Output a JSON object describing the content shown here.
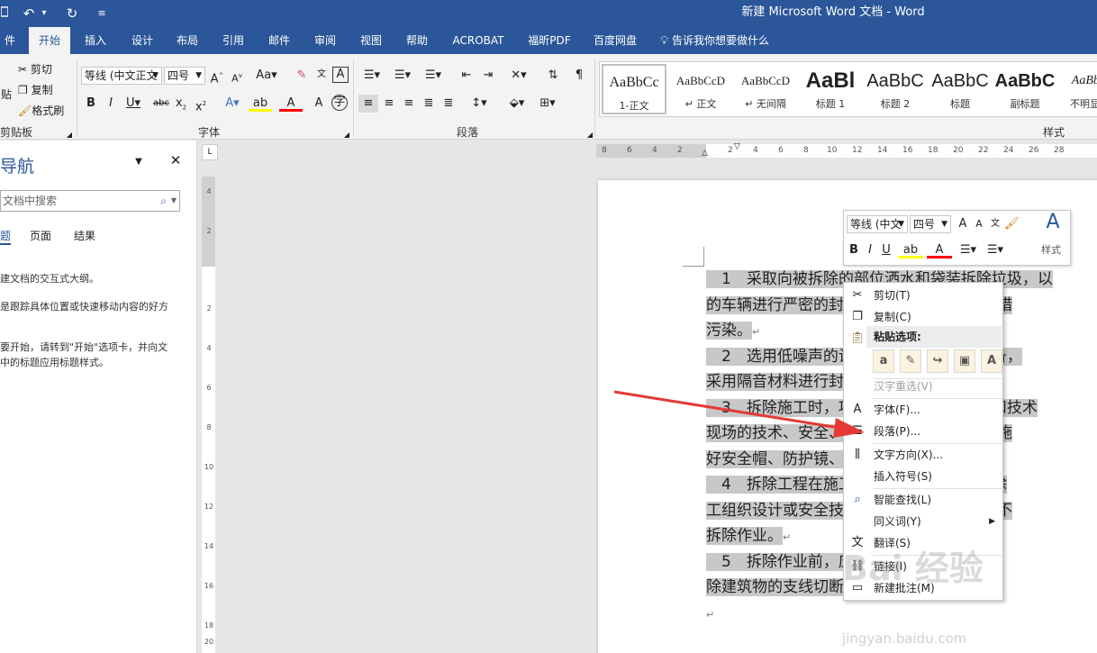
{
  "window": {
    "title": "新建 Microsoft Word 文档  -  Word"
  },
  "qat": {
    "save_icon": "save-icon",
    "undo": "↶",
    "undo_caret": "▾",
    "redo": "↻",
    "customize": "≡"
  },
  "tabs": [
    "件",
    "开始",
    "插入",
    "设计",
    "布局",
    "引用",
    "邮件",
    "审阅",
    "视图",
    "帮助",
    "ACROBAT",
    "福昕PDF",
    "百度网盘"
  ],
  "tell_me": "告诉我你想要做什么",
  "ribbon": {
    "clipboard": {
      "cut": "剪切",
      "copy": "复制",
      "format_painter": "格式刷",
      "paste": "贴",
      "label": "剪贴板"
    },
    "font": {
      "name": "等线 (中文正文",
      "size": "四号",
      "label": "字体"
    },
    "paragraph": {
      "label": "段落"
    },
    "styles": {
      "label": "样式",
      "items": [
        {
          "preview": "AaBbCc",
          "name": "1-正文"
        },
        {
          "preview": "AaBbCcD",
          "name": "↵ 正文"
        },
        {
          "preview": "AaBbCcD",
          "name": "↵ 无间隔"
        },
        {
          "preview": "AaBl",
          "name": "标题 1"
        },
        {
          "preview": "AaBbC",
          "name": "标题 2"
        },
        {
          "preview": "AaBbC",
          "name": "标题"
        },
        {
          "preview": "AaBbC",
          "name": "副标题"
        },
        {
          "preview": "AaBbC",
          "name": "不明显强"
        }
      ]
    }
  },
  "nav": {
    "title": "导航",
    "search_placeholder": "文档中搜索",
    "tabs": [
      "题",
      "页面",
      "结果"
    ],
    "p1": "建文档的交互式大纲。",
    "p2": "是跟踪具体位置或快速移动内容的好方",
    "p3a": "要开始，请转到\"开始\"选项卡，并向文",
    "p3b": "中的标题应用标题样式。"
  },
  "ruler": {
    "h": [
      "8",
      "6",
      "4",
      "2",
      "2",
      "4",
      "6",
      "8",
      "10",
      "12",
      "14",
      "16",
      "18",
      "20",
      "22",
      "24",
      "26",
      "28"
    ],
    "v": [
      "4",
      "2",
      "2",
      "4",
      "6",
      "8",
      "10",
      "12",
      "14",
      "16",
      "18",
      "20"
    ]
  },
  "doc": {
    "lines": [
      "　1　采取向被拆除的部位洒水和袋装拆除垃圾，以",
      "的车辆进行严密的封闭和对车辆进行冲洗等措",
      "污染。",
      "　2　选用低噪声的设备，选用噪声小的设备，",
      "采用隔音材料进行封闭。",
      "　3　拆除施工时，项目负责人、管理人员和技术",
      "现场的技术、安全、质量管理工作。并且对施",
      "好安全帽、防护镜、手套等劳保用品。",
      "　4　拆除工程在施工前应组织学习专项拆除",
      "工组织设计或安全技术措施，及技术措施的不",
      "拆除作业。",
      "　5　拆除作业前，应将电线、设备等干线",
      "除建筑物的支线切断。"
    ],
    "para_mark": "↵"
  },
  "mini_toolbar": {
    "font": "等线 (中文",
    "size": "四号",
    "styles_label": "样式"
  },
  "context_menu": {
    "cut": "剪切(T)",
    "copy": "复制(C)",
    "paste_header": "粘贴选项:",
    "hanzi": "汉字重选(V)",
    "font": "字体(F)...",
    "paragraph": "段落(P)...",
    "text_direction": "文字方向(X)...",
    "insert_symbol": "插入符号(S)",
    "smart_lookup": "智能查找(L)",
    "synonyms": "同义词(Y)",
    "translate": "翻译(S)",
    "link": "链接(I)",
    "new_comment": "新建批注(M)"
  },
  "annotation": {
    "arrow_color": "#e53935"
  },
  "watermark": {
    "logo": "Bai 经验",
    "url": "jingyan.baidu.com"
  },
  "colors": {
    "accent": "#2b579a",
    "highlight_yellow": "#ffff00",
    "font_red": "#ff0000"
  }
}
